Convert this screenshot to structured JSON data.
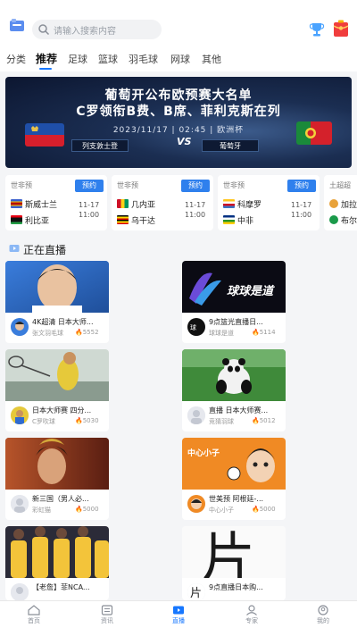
{
  "header": {
    "search_placeholder": "请输入搜索内容"
  },
  "tabs": [
    "分类",
    "推荐",
    "足球",
    "篮球",
    "羽毛球",
    "网球",
    "其他"
  ],
  "active_tab_index": 1,
  "banner": {
    "line1": "葡萄开公布欧预赛大名单",
    "line2": "C罗领衔B费、B席、菲利克斯在列",
    "meta": "2023/11/17 | 02:45 | 欧洲杯",
    "team_left": "列支敦士登",
    "vs": "VS",
    "team_right": "葡萄牙",
    "slides": 5,
    "active_slide": 0
  },
  "matches": [
    {
      "category": "世非预",
      "reserve_label": "预约",
      "home": "斯威士兰",
      "away": "利比亚",
      "date": "11-17",
      "time": "11:00"
    },
    {
      "category": "世非预",
      "reserve_label": "预约",
      "home": "几内亚",
      "away": "乌干达",
      "date": "11-17",
      "time": "11:00"
    },
    {
      "category": "世非预",
      "reserve_label": "预约",
      "home": "科摩罗",
      "away": "中非",
      "date": "11-17",
      "time": "11:00"
    },
    {
      "category": "土超超",
      "reserve_label": "",
      "home": "加拉",
      "away": "布尔",
      "date": "",
      "time": ""
    }
  ],
  "live": {
    "title": "正在直播",
    "streams": [
      {
        "title": "4K超清 日本大师...",
        "author": "张文羽毛球",
        "heat": "5552"
      },
      {
        "title": "9点篮光直播日...",
        "author": "球球是道",
        "heat": "5114"
      },
      {
        "title": "日本大师赛 四分...",
        "author": "C罗吹球",
        "heat": "5030"
      },
      {
        "title": "直播 日本大师赛...",
        "author": "竞猜羽球",
        "heat": "5012"
      },
      {
        "title": "新三国（男人必...",
        "author": "彩虹猫",
        "heat": "5000"
      },
      {
        "title": "世美预 阿根廷-...",
        "author": "中心小子",
        "heat": "5000"
      },
      {
        "title": "【老詹】菲NCA...",
        "author": "",
        "heat": ""
      },
      {
        "title": "9点直播日本购...",
        "author": "",
        "heat": ""
      }
    ],
    "thumb_texts": {
      "qiuqiu": "球球是道",
      "zhongxin": "中心小子",
      "char": "片"
    }
  },
  "bottom_nav": [
    {
      "label": "首页",
      "icon": "home-icon"
    },
    {
      "label": "资讯",
      "icon": "news-icon"
    },
    {
      "label": "直播",
      "icon": "live-icon"
    },
    {
      "label": "专家",
      "icon": "expert-icon"
    },
    {
      "label": "我的",
      "icon": "profile-icon"
    }
  ],
  "active_nav_index": 2,
  "colors": {
    "accent": "#1677ff",
    "reserve_button": "#2f80ed",
    "fire": "#ff6a1a"
  }
}
